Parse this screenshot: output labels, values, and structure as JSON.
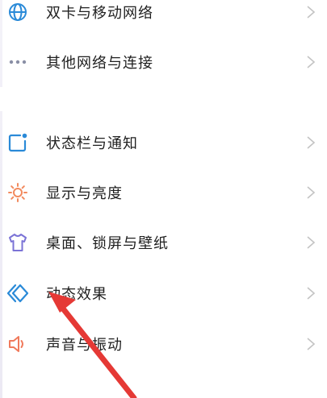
{
  "settings": {
    "items": [
      {
        "label": "双卡与移动网络",
        "icon": "globe-icon",
        "color": "#2a8ad8"
      },
      {
        "label": "其他网络与连接",
        "icon": "more-dots-icon",
        "color": "#8a8fa6"
      },
      {
        "label": "状态栏与通知",
        "icon": "notification-square-icon",
        "color": "#2a8ad8"
      },
      {
        "label": "显示与亮度",
        "icon": "sun-icon",
        "color": "#f28a5e"
      },
      {
        "label": "桌面、锁屏与壁纸",
        "icon": "tshirt-icon",
        "color": "#7b73d6"
      },
      {
        "label": "动态效果",
        "icon": "diamond-motion-icon",
        "color": "#2a8ad8"
      },
      {
        "label": "声音与振动",
        "icon": "speaker-icon",
        "color": "#f07a5c"
      }
    ]
  },
  "annotation": {
    "arrow_color": "#e53935"
  }
}
